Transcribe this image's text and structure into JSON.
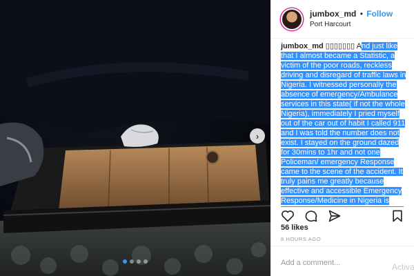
{
  "header": {
    "username": "jumbox_md",
    "separator": "•",
    "follow_label": "Follow",
    "location": "Port Harcourt"
  },
  "caption": {
    "username": "jumbox_md",
    "emoji": "▯▯▯▯▯▯▯",
    "lead": "A",
    "text": "nd just like that I almost became a Statistic, a victim of the poor roads, reckless driving and disregard of traffic laws in Nigeria. I witnessed personally the absence of emergency/Ambulance services in this state( if not the whole Nigeria), immediately I pried myself out of the car out of habit I called 911 and I was told the number does not exist. I stayed on the ground dazed for 30mins to 1hr and not one Policeman/ emergency Response came to the scene of the accident. It truly pains me greatly because effective and accessible Emergency Response/Medicine in Nigeria is what my Dad fought for till his death. One thing I know is as soon as Daddy closed his eyes forever, I gained an Angel who's never closes watching me constantly, that I could walk out of a car"
  },
  "photo": {
    "description_icon": "wrecked-car-photo",
    "carousel_count": 4,
    "carousel_active": 1,
    "next_icon": "chevron-right-icon",
    "next_glyph": "›"
  },
  "actions": {
    "like_icon": "heart-icon",
    "comment_icon": "comment-icon",
    "share_icon": "share-icon",
    "save_icon": "bookmark-icon"
  },
  "likes": "56 likes",
  "time": "8 HOURS AGO",
  "comment": {
    "placeholder": "Add a comment..."
  },
  "watermark": "Activat",
  "colors": {
    "accent": "#3897f0",
    "highlight": "#3390ff",
    "text": "#262626",
    "muted": "#999999"
  }
}
